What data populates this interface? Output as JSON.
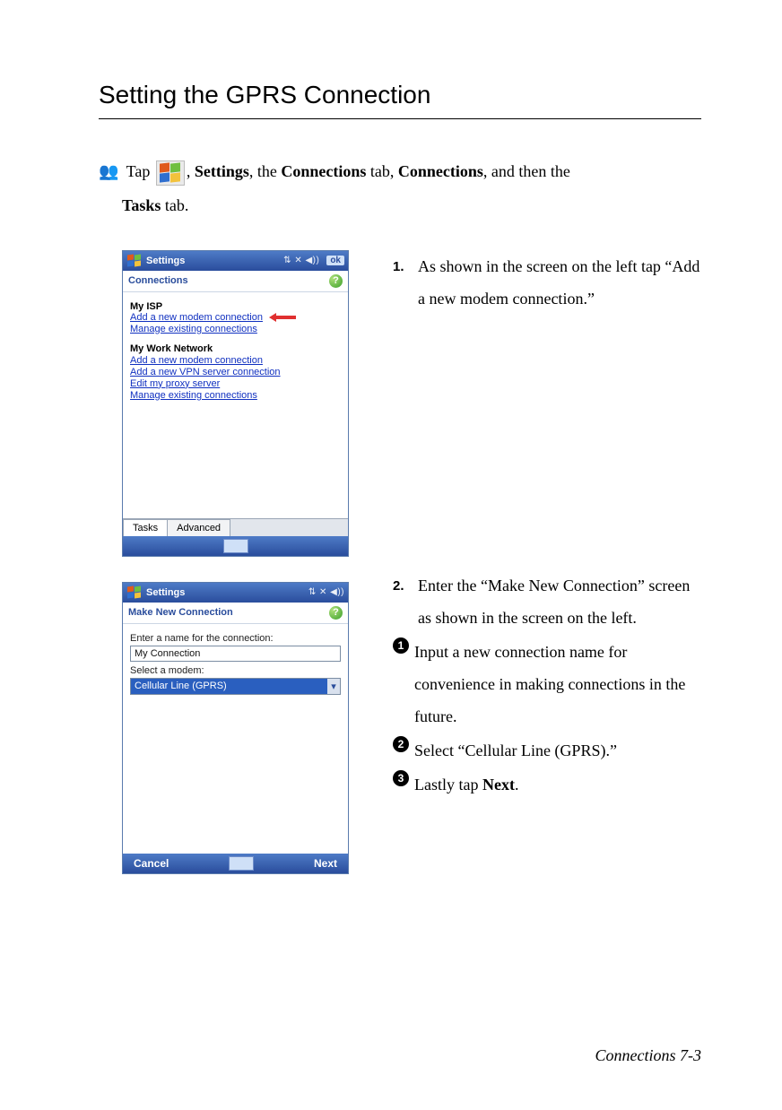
{
  "title": "Setting the GPRS Connection",
  "intro": {
    "prefix_icon": "people-icon",
    "tap": "Tap",
    "settings": "Settings",
    "the": ", the ",
    "connections_tab": "Connections",
    "tab_word": " tab, ",
    "connections": "Connections",
    "and_then_the": ", and then the ",
    "tasks": "Tasks",
    "tab_word2": " tab."
  },
  "screenshot1": {
    "titlebar": "Settings",
    "ok": "ok",
    "subtitle": "Connections",
    "groups": [
      {
        "title": "My ISP",
        "links": [
          {
            "text": "Add a new modem connection",
            "arrow": true
          },
          {
            "text": "Manage existing connections",
            "arrow": false
          }
        ]
      },
      {
        "title": "My Work Network",
        "links": [
          {
            "text": "Add a new modem connection",
            "arrow": false
          },
          {
            "text": "Add a new VPN server connection",
            "arrow": false
          },
          {
            "text": "Edit my proxy server",
            "arrow": false
          },
          {
            "text": "Manage existing connections",
            "arrow": false
          }
        ]
      }
    ],
    "tabs": {
      "active": "Tasks",
      "other": "Advanced"
    }
  },
  "screenshot2": {
    "titlebar": "Settings",
    "subtitle": "Make New Connection",
    "name_label": "Enter a name for the connection:",
    "name_value": "My Connection",
    "modem_label": "Select a modem:",
    "modem_value": "Cellular Line (GPRS)",
    "cancel": "Cancel",
    "next": "Next"
  },
  "step1": {
    "num": "1.",
    "text": "As shown in the screen on the left tap “Add a new modem connection.”"
  },
  "step2": {
    "num": "2.",
    "text": "Enter the “Make New Connection” screen as shown in the screen on the left.",
    "bullets": [
      "Input a new connection name for convenience in making connections in the future.",
      "Select “Cellular Line (GPRS).”",
      "Lastly tap Next."
    ],
    "next_bold": "Next"
  },
  "footer": "Connections    7-3"
}
